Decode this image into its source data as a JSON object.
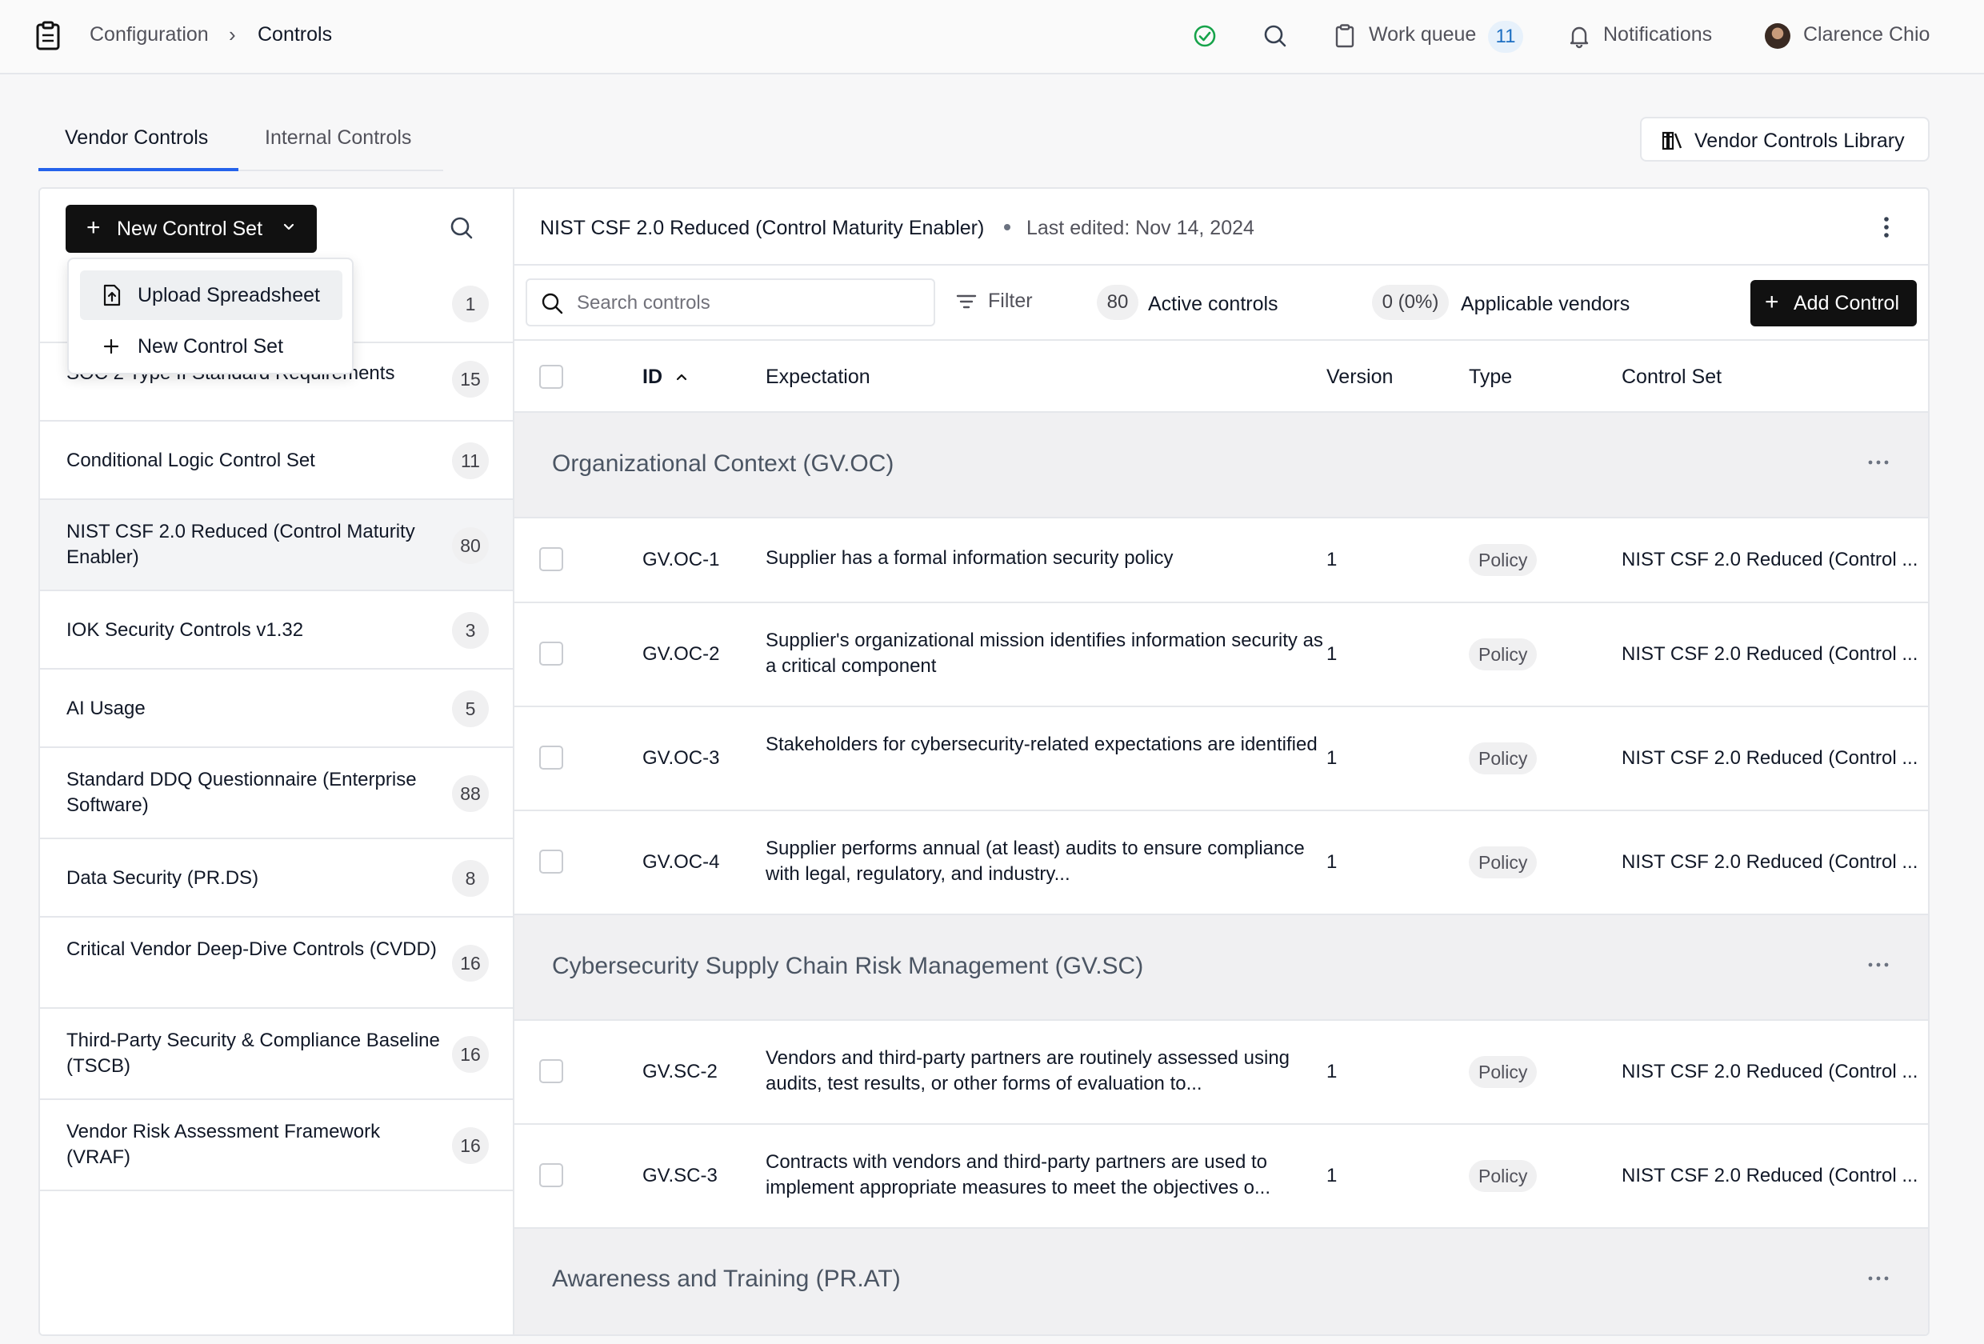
{
  "breadcrumb": {
    "parent": "Configuration",
    "separator": "›",
    "current": "Controls"
  },
  "topbar": {
    "work_queue_label": "Work queue",
    "work_queue_count": "11",
    "notifications_label": "Notifications",
    "user_name": "Clarence Chio"
  },
  "tabs": {
    "vendor": "Vendor Controls",
    "internal": "Internal Controls"
  },
  "library_button": "Vendor Controls Library",
  "left_panel": {
    "new_button": "New Control Set",
    "dropdown": {
      "upload": "Upload Spreadsheet",
      "new": "New Control Set"
    },
    "items": [
      {
        "name": "",
        "count": "1"
      },
      {
        "name": "SOC 2 Type II Standard Requirements",
        "count": "15"
      },
      {
        "name": "Conditional Logic Control Set",
        "count": "11"
      },
      {
        "name": "NIST CSF 2.0 Reduced (Control Maturity Enabler)",
        "count": "80"
      },
      {
        "name": "IOK Security Controls v1.32",
        "count": "3"
      },
      {
        "name": "AI Usage",
        "count": "5"
      },
      {
        "name": "Standard DDQ Questionnaire (Enterprise Software)",
        "count": "88"
      },
      {
        "name": "Data Security (PR.DS)",
        "count": "8"
      },
      {
        "name": "Critical Vendor Deep-Dive Controls (CVDD)",
        "count": "16"
      },
      {
        "name": "Third-Party Security & Compliance Baseline (TSCB)",
        "count": "16"
      },
      {
        "name": "Vendor Risk Assessment Framework (VRAF)",
        "count": "16"
      }
    ]
  },
  "detail": {
    "title": "NIST CSF 2.0 Reduced (Control Maturity Enabler)",
    "last_edited": "Last edited: Nov 14, 2024",
    "search_placeholder": "Search controls",
    "filter_label": "Filter",
    "active_count": "80",
    "active_label": "Active controls",
    "applicable_count": "0 (0%)",
    "applicable_label": "Applicable vendors",
    "add_button": "Add Control",
    "columns": {
      "id": "ID",
      "expectation": "Expectation",
      "version": "Version",
      "type": "Type",
      "control_set": "Control Set"
    },
    "groups": [
      {
        "name": "Organizational Context (GV.OC)",
        "rows": [
          {
            "id": "GV.OC-1",
            "expectation": "Supplier has a formal information security policy",
            "version": "1",
            "type": "Policy",
            "control_set": "NIST CSF 2.0 Reduced (Control ..."
          },
          {
            "id": "GV.OC-2",
            "expectation": "Supplier's organizational mission identifies information security as a critical component",
            "version": "1",
            "type": "Policy",
            "control_set": "NIST CSF 2.0 Reduced (Control ..."
          },
          {
            "id": "GV.OC-3",
            "expectation": "Stakeholders for cybersecurity-related expectations are identified",
            "version": "1",
            "type": "Policy",
            "control_set": "NIST CSF 2.0 Reduced (Control ..."
          },
          {
            "id": "GV.OC-4",
            "expectation": "Supplier performs annual (at least) audits to ensure compliance with legal, regulatory, and industry...",
            "version": "1",
            "type": "Policy",
            "control_set": "NIST CSF 2.0 Reduced (Control ..."
          }
        ]
      },
      {
        "name": "Cybersecurity Supply Chain Risk Management (GV.SC)",
        "rows": [
          {
            "id": "GV.SC-2",
            "expectation": "Vendors and third-party partners are routinely assessed using audits, test results, or other forms of evaluation to...",
            "version": "1",
            "type": "Policy",
            "control_set": "NIST CSF 2.0 Reduced (Control ..."
          },
          {
            "id": "GV.SC-3",
            "expectation": "Contracts with vendors and third-party partners are used to implement appropriate measures to meet the objectives o...",
            "version": "1",
            "type": "Policy",
            "control_set": "NIST CSF 2.0 Reduced (Control ..."
          }
        ]
      },
      {
        "name": "Awareness and Training (PR.AT)",
        "rows": []
      }
    ]
  },
  "colors": {
    "accent": "#2563eb",
    "primary_button": "#111111",
    "badge_blue": "#1d6fc2",
    "status_ok": "#16a34a"
  }
}
